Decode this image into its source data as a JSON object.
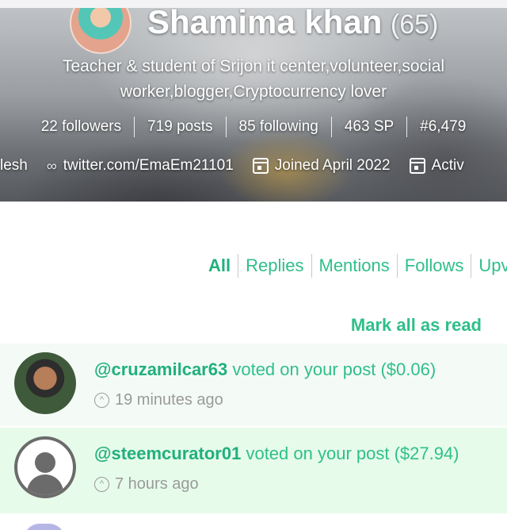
{
  "profile": {
    "name": "Shamima khan",
    "reputation": "(65)",
    "bio_line1": "Teacher & student of Srijon it center,volunteer,social",
    "bio_line2": "worker,blogger,Cryptocurrency lover",
    "stats": {
      "followers": "22 followers",
      "posts": "719 posts",
      "following": "85 following",
      "sp": "463 SP",
      "rank": "#6,479"
    },
    "meta": {
      "location": "lesh",
      "website": "twitter.com/EmaEm21101",
      "joined": "Joined April 2022",
      "active": "Activ"
    }
  },
  "filters": {
    "tabs": [
      "All",
      "Replies",
      "Mentions",
      "Follows",
      "Upv"
    ]
  },
  "mark_all_label": "Mark all as read",
  "notifications": [
    {
      "user": "@cruzamilcar63",
      "action": "voted on your post ($0.06)",
      "time": "19 minutes ago"
    },
    {
      "user": "@steemcurator01",
      "action": "voted on your post ($27.94)",
      "time": "7 hours ago"
    }
  ],
  "colors": {
    "accent": "#2fbf8a",
    "highlight_bg": "#e6fbe9"
  }
}
